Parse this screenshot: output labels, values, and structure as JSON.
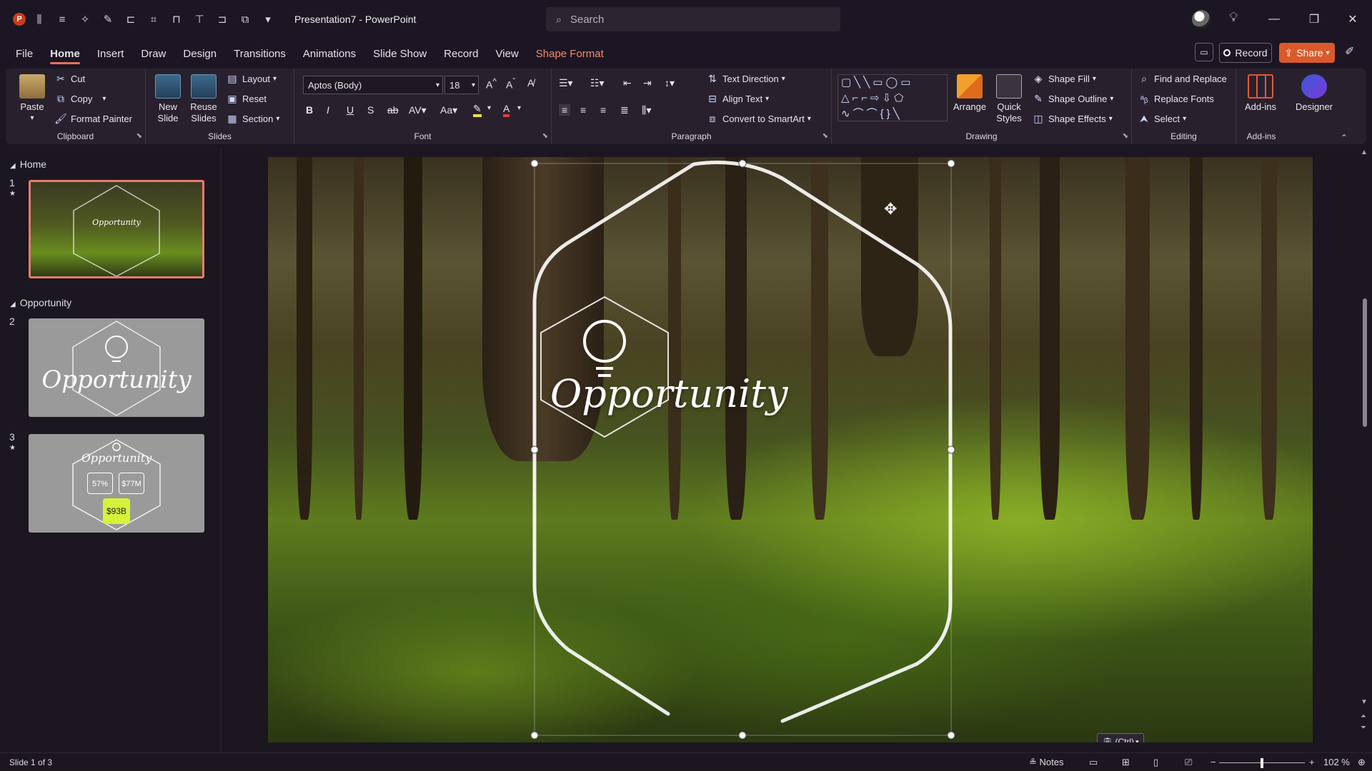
{
  "titlebar": {
    "title": "Presentation7  -  PowerPoint",
    "search_placeholder": "Search",
    "app_logo_letter": "P"
  },
  "menu": {
    "tabs": [
      "File",
      "Home",
      "Insert",
      "Draw",
      "Design",
      "Transitions",
      "Animations",
      "Slide Show",
      "Record",
      "View",
      "Shape Format"
    ],
    "active": "Home",
    "record_label": "Record",
    "share_label": "Share"
  },
  "ribbon": {
    "clipboard": {
      "label": "Clipboard",
      "paste": "Paste",
      "cut": "Cut",
      "copy": "Copy",
      "format_painter": "Format Painter"
    },
    "slides": {
      "label": "Slides",
      "new_slide": "New Slide",
      "reuse_slides": "Reuse Slides",
      "layout": "Layout",
      "reset": "Reset",
      "section": "Section"
    },
    "font": {
      "label": "Font",
      "font_name": "Aptos (Body)",
      "font_size": "18"
    },
    "paragraph": {
      "label": "Paragraph",
      "text_direction": "Text Direction",
      "align_text": "Align Text",
      "convert_smartart": "Convert to SmartArt"
    },
    "drawing": {
      "label": "Drawing",
      "arrange": "Arrange",
      "quick_styles": "Quick Styles",
      "shape_fill": "Shape Fill",
      "shape_outline": "Shape Outline",
      "shape_effects": "Shape Effects"
    },
    "editing": {
      "label": "Editing",
      "find_replace": "Find and Replace",
      "replace_fonts": "Replace Fonts",
      "select": "Select"
    },
    "addins": {
      "label": "Add-ins",
      "addins": "Add-ins",
      "designer": "Designer"
    }
  },
  "thumbnails": {
    "sections": [
      "Home",
      "Opportunity"
    ],
    "slides": [
      {
        "num": "1",
        "text": "Opportunity"
      },
      {
        "num": "2",
        "text": "Opportunity"
      },
      {
        "num": "3",
        "text": "Opportunity",
        "stat1": "57%",
        "stat2": "$77M",
        "stat3": "$93B"
      }
    ]
  },
  "slide": {
    "title": "Opportunity",
    "paste_options": "(Ctrl)"
  },
  "status": {
    "slide_info": "Slide 1 of 3",
    "notes": "Notes",
    "zoom": "102 %"
  },
  "colors": {
    "accent": "#e0735a",
    "share": "#d95a2b",
    "selection_border": "#e87b6e"
  }
}
